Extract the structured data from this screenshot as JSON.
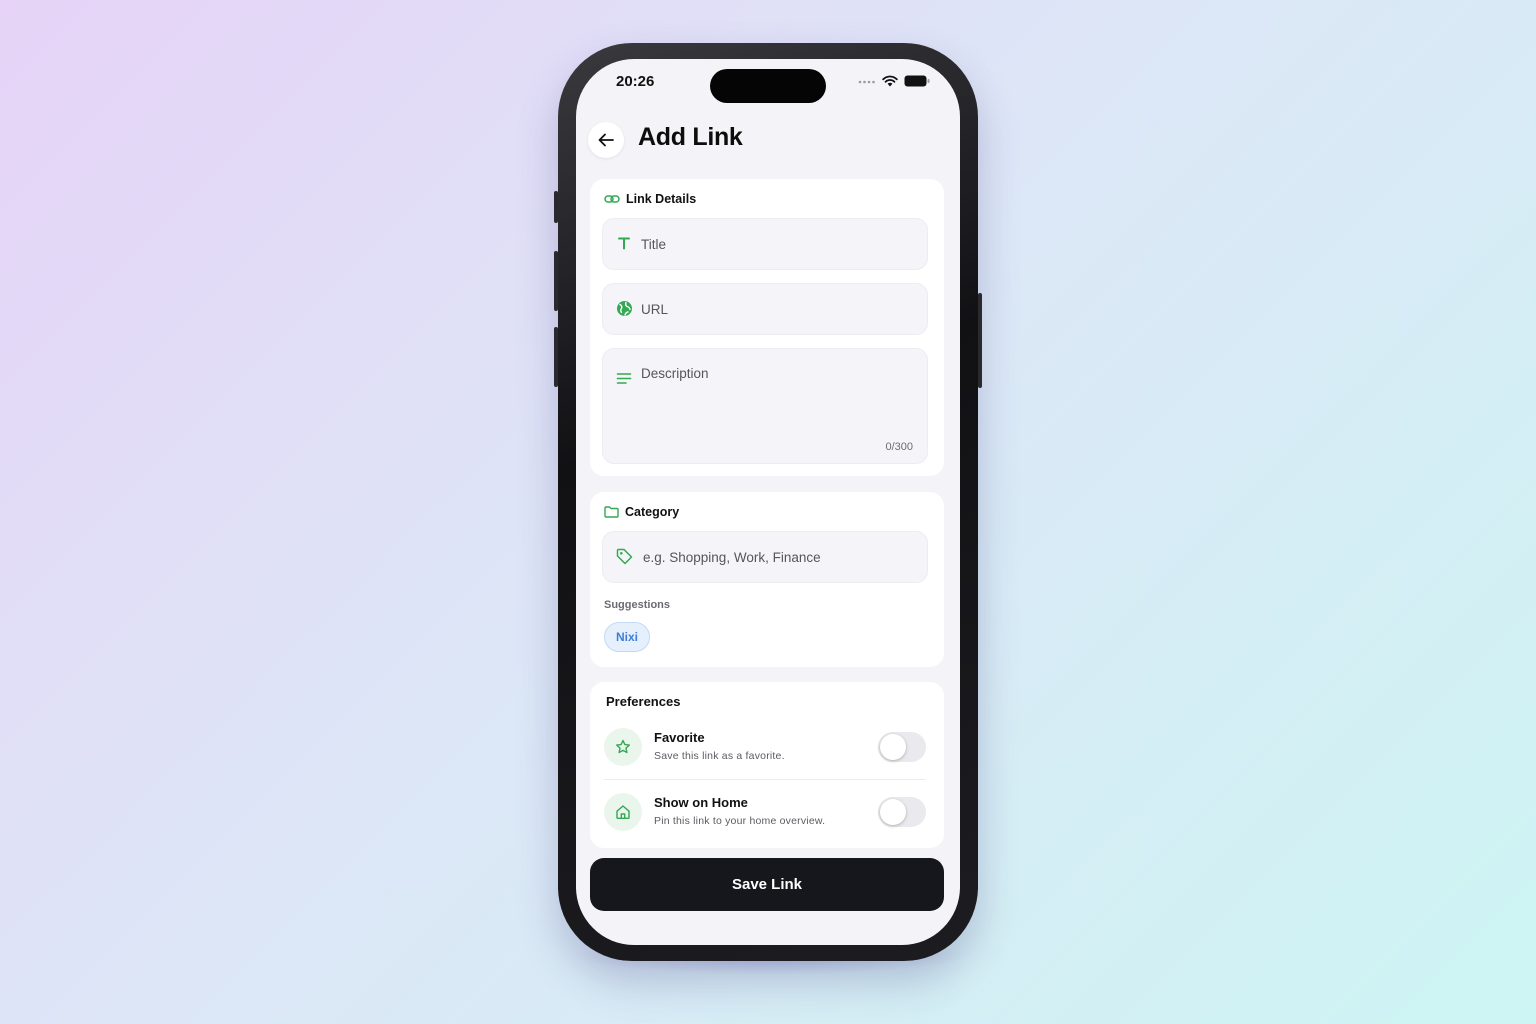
{
  "status_bar": {
    "time": "20:26",
    "icons": [
      "cellular-dots-icon",
      "wifi-icon",
      "battery-icon"
    ]
  },
  "header": {
    "back_icon": "arrow-left-icon",
    "title": "Add Link"
  },
  "link_details": {
    "title": "Link Details",
    "icon": "link-icon",
    "title_field": {
      "placeholder": "Title",
      "value": "",
      "icon": "text-t-icon"
    },
    "url_field": {
      "placeholder": "URL",
      "value": "",
      "icon": "globe-icon"
    },
    "description_field": {
      "placeholder": "Description",
      "value": "",
      "icon": "lines-icon",
      "counter": "0/300"
    }
  },
  "category": {
    "title": "Category",
    "icon": "folder-icon",
    "input": {
      "placeholder": "e.g. Shopping, Work, Finance",
      "value": "",
      "icon": "tag-icon"
    },
    "suggestions_label": "Suggestions",
    "suggestions": [
      "Nixi"
    ]
  },
  "preferences": {
    "title": "Preferences",
    "items": [
      {
        "title": "Favorite",
        "description": "Save this link as a favorite.",
        "icon": "star-icon",
        "enabled": false
      },
      {
        "title": "Show on Home",
        "description": "Pin this link to your home overview.",
        "icon": "home-icon",
        "enabled": false
      }
    ]
  },
  "footer": {
    "save_label": "Save Link"
  },
  "colors": {
    "accent_green": "#34a853",
    "primary_dark": "#16161d",
    "chip_blue": "#3d7fd6"
  }
}
